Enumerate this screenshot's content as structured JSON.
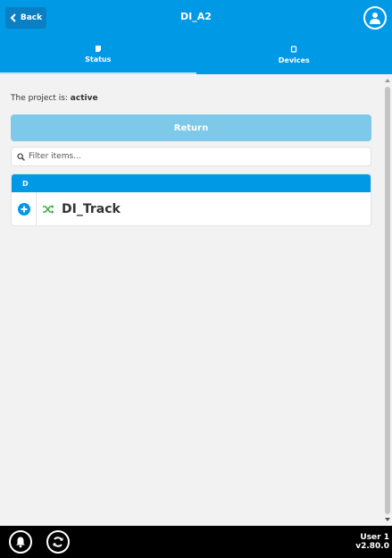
{
  "header": {
    "back_label": "Back",
    "title": "DI_A2"
  },
  "tabs": [
    {
      "label": "Status",
      "icon": "status-icon",
      "active": true
    },
    {
      "label": "Devices",
      "icon": "devices-icon",
      "active": false
    }
  ],
  "status": {
    "prefix": "The project is:",
    "value": "active"
  },
  "return_button": "Return",
  "filter": {
    "placeholder": "Filter items..."
  },
  "group": {
    "header": "D",
    "items": [
      {
        "label": "DI_Track",
        "icon": "shuffle-icon"
      }
    ]
  },
  "footer": {
    "user": "User 1",
    "version": "v2.80.0"
  },
  "colors": {
    "primary": "#0099e6",
    "button_light": "#7ec8ea",
    "shuffle_green": "#3cb043"
  }
}
